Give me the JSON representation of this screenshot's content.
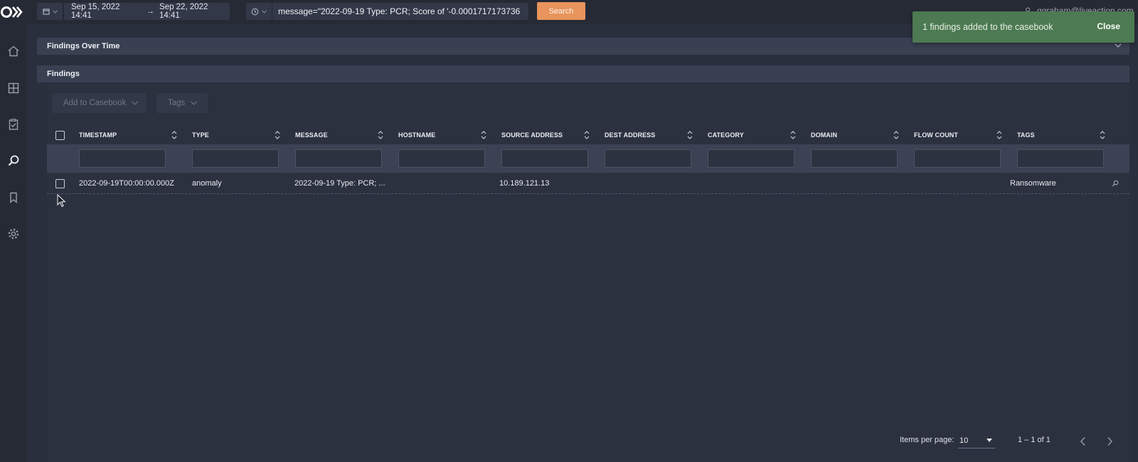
{
  "topbar": {
    "date_start": "Sep 15, 2022 14:41",
    "date_arrow": "→",
    "date_end": "Sep 22, 2022 14:41",
    "query_value": "message=\"2022-09-19 Type: PCR; Score of '-0.0001717173736",
    "search_label": "Search",
    "user_email": "ggraham@liveaction.com"
  },
  "panels": {
    "over_time_title": "Findings Over Time",
    "findings_title": "Findings"
  },
  "toolbar": {
    "add_to_casebook": "Add to Casebook",
    "tags": "Tags"
  },
  "table": {
    "columns": [
      "TIMESTAMP",
      "TYPE",
      "MESSAGE",
      "HOSTNAME",
      "SOURCE ADDRESS",
      "DEST ADDRESS",
      "CATEGORY",
      "DOMAIN",
      "FLOW COUNT",
      "TAGS"
    ],
    "rows": [
      {
        "timestamp": "2022-09-19T00:00:00.000Z",
        "type": "anomaly",
        "message": "2022-09-19 Type: PCR; ...",
        "hostname": "",
        "source_address": "10.189.121.13",
        "dest_address": "",
        "category": "",
        "domain": "",
        "flow_count": "",
        "tags": "Ransomware"
      }
    ]
  },
  "toast": {
    "message": "1 findings added to the casebook",
    "close_label": "Close",
    "color": "#4d7a52"
  },
  "paginator": {
    "items_per_page_label": "Items per page:",
    "items_per_page_value": "10",
    "range_label": "1 – 1 of 1"
  },
  "colors": {
    "accent": "#e8945c",
    "background": "#2a2f3d",
    "panel_header": "#384052"
  },
  "icons": {
    "logo": "liveaction-logo",
    "sidebar": [
      "home-icon",
      "dashboard-grid-icon",
      "clipboard-icon",
      "search-icon",
      "bookmark-icon",
      "gear-icon"
    ]
  }
}
